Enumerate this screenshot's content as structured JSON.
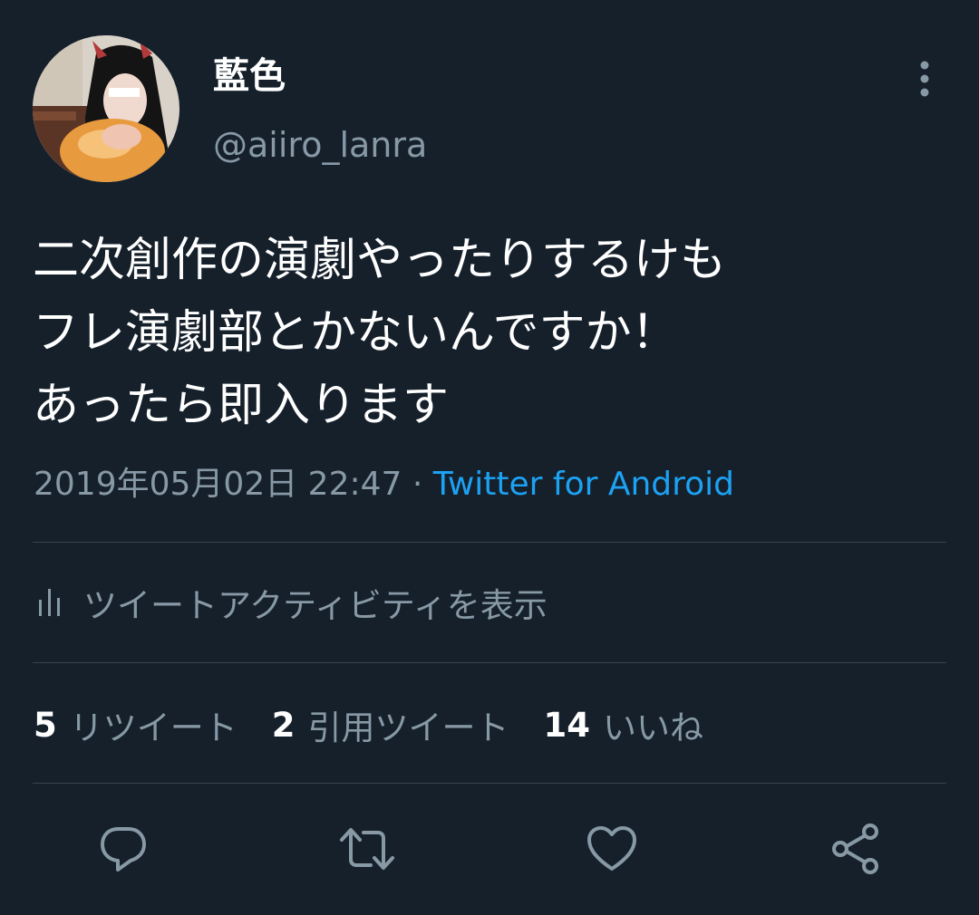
{
  "tweet": {
    "author": {
      "display_name": "藍色",
      "username": "@aiiro_lanra"
    },
    "text_lines": [
      "二次創作の演劇やったりするけも",
      "フレ演劇部とかないんですか！",
      "あったら即入ります"
    ],
    "timestamp": "2019年05月02日 22:47",
    "separator": "·",
    "source": "Twitter for Android",
    "activity_label": "ツイートアクティビティを表示",
    "stats": {
      "retweets": {
        "count": "5",
        "label": "リツイート"
      },
      "quotes": {
        "count": "2",
        "label": "引用ツイート"
      },
      "likes": {
        "count": "14",
        "label": "いいね"
      }
    }
  },
  "actions": {
    "reply_icon": "reply-icon",
    "retweet_icon": "retweet-icon",
    "like_icon": "heart-icon",
    "share_icon": "share-icon"
  },
  "colors": {
    "background": "#15202b",
    "primary_text": "#ffffff",
    "secondary_text": "#8899a6",
    "link": "#1da1f2",
    "divider": "#38444d"
  }
}
